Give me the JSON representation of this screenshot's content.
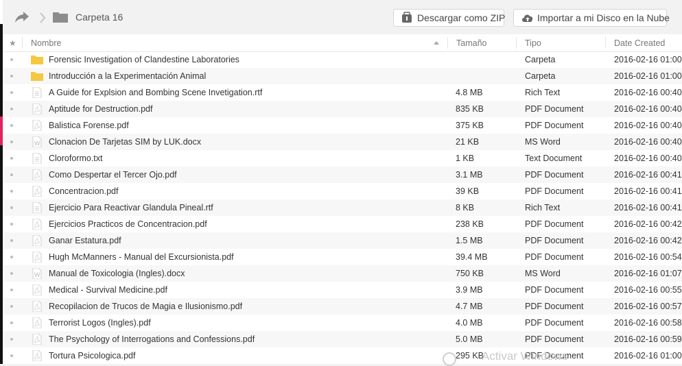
{
  "breadcrumb": {
    "title": "Carpeta 16"
  },
  "toolbar": {
    "download_zip_label": "Descargar como ZIP",
    "import_cloud_label": "Importar a mi Disco en la Nube"
  },
  "columns": {
    "name": "Nombre",
    "size": "Tamaño",
    "type": "Tipo",
    "date": "Date Created"
  },
  "files": [
    {
      "name": "Forensic Investigation of Clandestine Laboratories",
      "size": "",
      "type": "Carpeta",
      "date": "2016-02-16 01:00",
      "icon": "folder-icon"
    },
    {
      "name": "Introducción a la Experimentación Animal",
      "size": "",
      "type": "Carpeta",
      "date": "2016-02-16 01:00",
      "icon": "folder-icon"
    },
    {
      "name": "A Guide for Explsion and Bombing Scene Invetigation.rtf",
      "size": "4.8 MB",
      "type": "Rich Text",
      "date": "2016-02-16 00:40",
      "icon": "text-file-icon"
    },
    {
      "name": "Aptitude for Destruction.pdf",
      "size": "835 KB",
      "type": "PDF Document",
      "date": "2016-02-16 00:40",
      "icon": "pdf-file-icon"
    },
    {
      "name": "Balistica Forense.pdf",
      "size": "375 KB",
      "type": "PDF Document",
      "date": "2016-02-16 00:40",
      "icon": "pdf-file-icon"
    },
    {
      "name": "Clonacion De Tarjetas SIM by LUK.docx",
      "size": "21 KB",
      "type": "MS Word",
      "date": "2016-02-16 00:40",
      "icon": "word-file-icon"
    },
    {
      "name": "Cloroformo.txt",
      "size": "1 KB",
      "type": "Text Document",
      "date": "2016-02-16 00:40",
      "icon": "text-file-icon"
    },
    {
      "name": "Como Despertar el Tercer Ojo.pdf",
      "size": "3.1 MB",
      "type": "PDF Document",
      "date": "2016-02-16 00:41",
      "icon": "pdf-file-icon"
    },
    {
      "name": "Concentracion.pdf",
      "size": "39 KB",
      "type": "PDF Document",
      "date": "2016-02-16 00:41",
      "icon": "pdf-file-icon"
    },
    {
      "name": "Ejercicio Para Reactivar Glandula Pineal.rtf",
      "size": "8 KB",
      "type": "Rich Text",
      "date": "2016-02-16 00:41",
      "icon": "text-file-icon"
    },
    {
      "name": "Ejercicios Practicos de Concentracion.pdf",
      "size": "238 KB",
      "type": "PDF Document",
      "date": "2016-02-16 00:42",
      "icon": "pdf-file-icon"
    },
    {
      "name": "Ganar Estatura.pdf",
      "size": "1.5 MB",
      "type": "PDF Document",
      "date": "2016-02-16 00:42",
      "icon": "pdf-file-icon"
    },
    {
      "name": "Hugh McManners - Manual del Excursionista.pdf",
      "size": "39.4 MB",
      "type": "PDF Document",
      "date": "2016-02-16 00:54",
      "icon": "pdf-file-icon"
    },
    {
      "name": "Manual de Toxicologia (Ingles).docx",
      "size": "750 KB",
      "type": "MS Word",
      "date": "2016-02-16 01:07",
      "icon": "word-file-icon"
    },
    {
      "name": "Medical - Survival Medicine.pdf",
      "size": "3.9 MB",
      "type": "PDF Document",
      "date": "2016-02-16 00:55",
      "icon": "pdf-file-icon"
    },
    {
      "name": "Recopilacion de Trucos de Magia e Ilusionismo.pdf",
      "size": "4.7 MB",
      "type": "PDF Document",
      "date": "2016-02-16 00:57",
      "icon": "pdf-file-icon"
    },
    {
      "name": "Terrorist Logos (Ingles).pdf",
      "size": "4.0 MB",
      "type": "PDF Document",
      "date": "2016-02-16 00:58",
      "icon": "pdf-file-icon"
    },
    {
      "name": "The Psychology of Interrogations and Confessions.pdf",
      "size": "5.0 MB",
      "type": "PDF Document",
      "date": "2016-02-16 00:59",
      "icon": "pdf-file-icon"
    },
    {
      "name": "Tortura Psicologica.pdf",
      "size": "295 KB",
      "type": "PDF Document",
      "date": "2016-02-16 01:00",
      "icon": "pdf-file-icon"
    }
  ],
  "watermark": "Activar Windows",
  "colors": {
    "folder": "#f5c842",
    "accent_bar": "#e0245e",
    "row_alt": "#f7f7f7"
  }
}
